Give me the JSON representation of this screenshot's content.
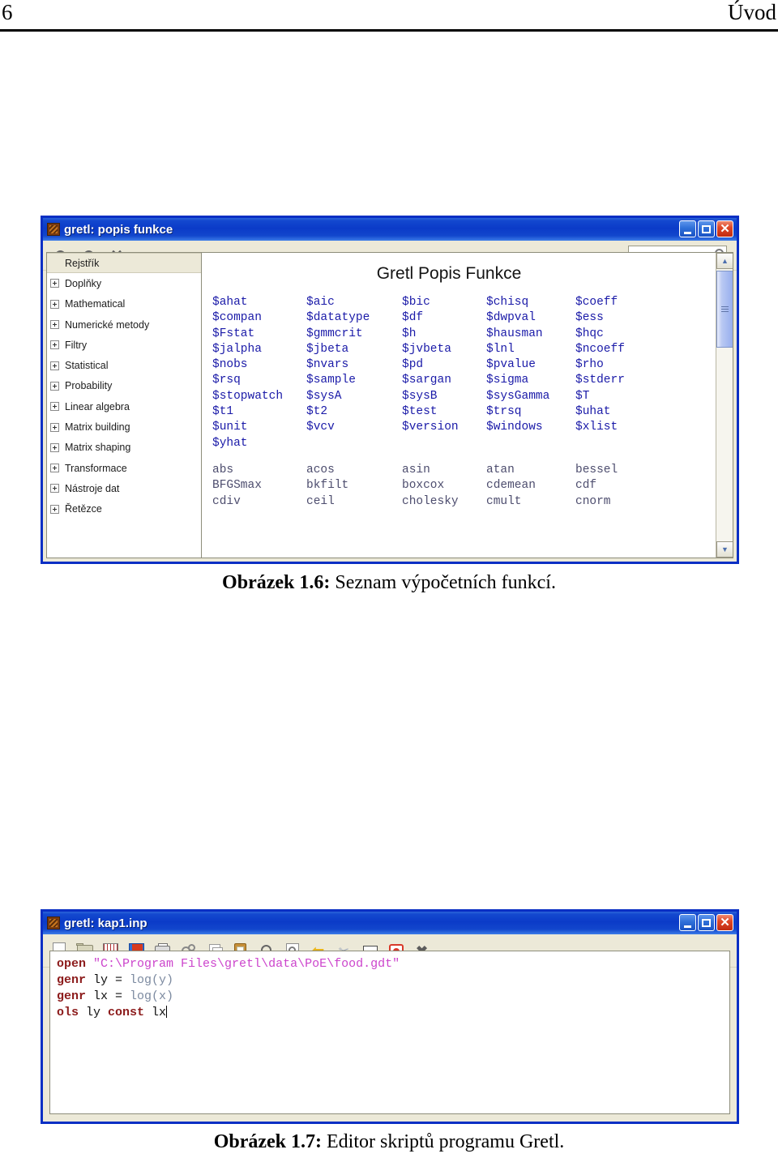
{
  "page": {
    "folio": "6",
    "running_head": "Úvod"
  },
  "help_window": {
    "title": "gretl: popis funkce",
    "title_icon": "gretl-app-icon",
    "window_buttons": {
      "minimize": "_",
      "maximize": "□",
      "close": "✕"
    },
    "toolbar": {
      "zoom_in": "+",
      "zoom_out": "−",
      "close": "✕"
    },
    "search": {
      "value": "",
      "placeholder": ""
    },
    "tree": {
      "items": [
        {
          "label": "Rejstřík",
          "expandable": false,
          "selected": true
        },
        {
          "label": "Doplňky",
          "expandable": true,
          "selected": false
        },
        {
          "label": "Mathematical",
          "expandable": true,
          "selected": false
        },
        {
          "label": "Numerické metody",
          "expandable": true,
          "selected": false
        },
        {
          "label": "Filtry",
          "expandable": true,
          "selected": false
        },
        {
          "label": "Statistical",
          "expandable": true,
          "selected": false
        },
        {
          "label": "Probability",
          "expandable": true,
          "selected": false
        },
        {
          "label": "Linear algebra",
          "expandable": true,
          "selected": false
        },
        {
          "label": "Matrix building",
          "expandable": true,
          "selected": false
        },
        {
          "label": "Matrix shaping",
          "expandable": true,
          "selected": false
        },
        {
          "label": "Transformace",
          "expandable": true,
          "selected": false
        },
        {
          "label": "Nástroje dat",
          "expandable": true,
          "selected": false
        },
        {
          "label": "Řetězce",
          "expandable": true,
          "selected": false
        }
      ]
    },
    "document": {
      "heading": "Gretl Popis Funkce",
      "accessor_functions": [
        "$ahat",
        "$aic",
        "$bic",
        "$chisq",
        "$coeff",
        "$compan",
        "$datatype",
        "$df",
        "$dwpval",
        "$ess",
        "$Fstat",
        "$gmmcrit",
        "$h",
        "$hausman",
        "$hqc",
        "$jalpha",
        "$jbeta",
        "$jvbeta",
        "$lnl",
        "$ncoeff",
        "$nobs",
        "$nvars",
        "$pd",
        "$pvalue",
        "$rho",
        "$rsq",
        "$sample",
        "$sargan",
        "$sigma",
        "$stderr",
        "$stopwatch",
        "$sysA",
        "$sysB",
        "$sysGamma",
        "$T",
        "$t1",
        "$t2",
        "$test",
        "$trsq",
        "$uhat",
        "$unit",
        "$vcv",
        "$version",
        "$windows",
        "$xlist",
        "$yhat"
      ],
      "builtin_functions": [
        "abs",
        "acos",
        "asin",
        "atan",
        "bessel",
        "BFGSmax",
        "bkfilt",
        "boxcox",
        "cdemean",
        "cdf",
        "cdiv",
        "ceil",
        "cholesky",
        "cmult",
        "cnorm"
      ],
      "scrollbar": {
        "up": "▲",
        "down": "▼"
      }
    }
  },
  "caption_1": {
    "label": "Obrázek 1.6:",
    "text": " Seznam výpočetních funkcí."
  },
  "editor_window": {
    "title": "gretl: kap1.inp",
    "title_icon": "gretl-app-icon",
    "window_buttons": {
      "minimize": "_",
      "maximize": "□",
      "close": "✕"
    },
    "toolbar_icons": [
      "new-file-icon",
      "open-folder-icon",
      "data-grid-icon",
      "save-icon",
      "print-icon",
      "gears-run-icon",
      "copy-icon",
      "paste-clipboard-icon",
      "find-icon",
      "find-replace-icon",
      "undo-icon",
      "scissors-cut-icon",
      "mail-icon",
      "help-bug-icon",
      "close-x-icon"
    ],
    "code_lines": [
      [
        {
          "t": "open",
          "c": "kw"
        },
        {
          "t": " ",
          "c": "plain"
        },
        {
          "t": "\"C:\\Program Files\\gretl\\data\\PoE\\food.gdt\"",
          "c": "str"
        }
      ],
      [
        {
          "t": "genr",
          "c": "kw"
        },
        {
          "t": " ly = ",
          "c": "plain"
        },
        {
          "t": "log",
          "c": "fnc"
        },
        {
          "t": "(y)",
          "c": "fnc"
        }
      ],
      [
        {
          "t": "genr",
          "c": "kw"
        },
        {
          "t": " lx = ",
          "c": "plain"
        },
        {
          "t": "log",
          "c": "fnc"
        },
        {
          "t": "(x)",
          "c": "fnc"
        }
      ],
      [
        {
          "t": "ols",
          "c": "kw"
        },
        {
          "t": " ly ",
          "c": "plain"
        },
        {
          "t": "const",
          "c": "kw"
        },
        {
          "t": " lx",
          "c": "plain"
        },
        {
          "t": "CARET",
          "c": "caret"
        }
      ]
    ]
  },
  "caption_2": {
    "label": "Obrázek 1.7:",
    "text": " Editor skriptů programu Gretl."
  },
  "colors": {
    "titlebar_blue": "#0b3bc8",
    "window_border": "#0a2fc4",
    "chrome_beige": "#ece9d8",
    "accessor_link": "#1a1aa8",
    "builtin_link": "#4d4d6e",
    "keyword": "#8c1b1b",
    "string": "#cc44cc",
    "function": "#7c8aa0"
  }
}
